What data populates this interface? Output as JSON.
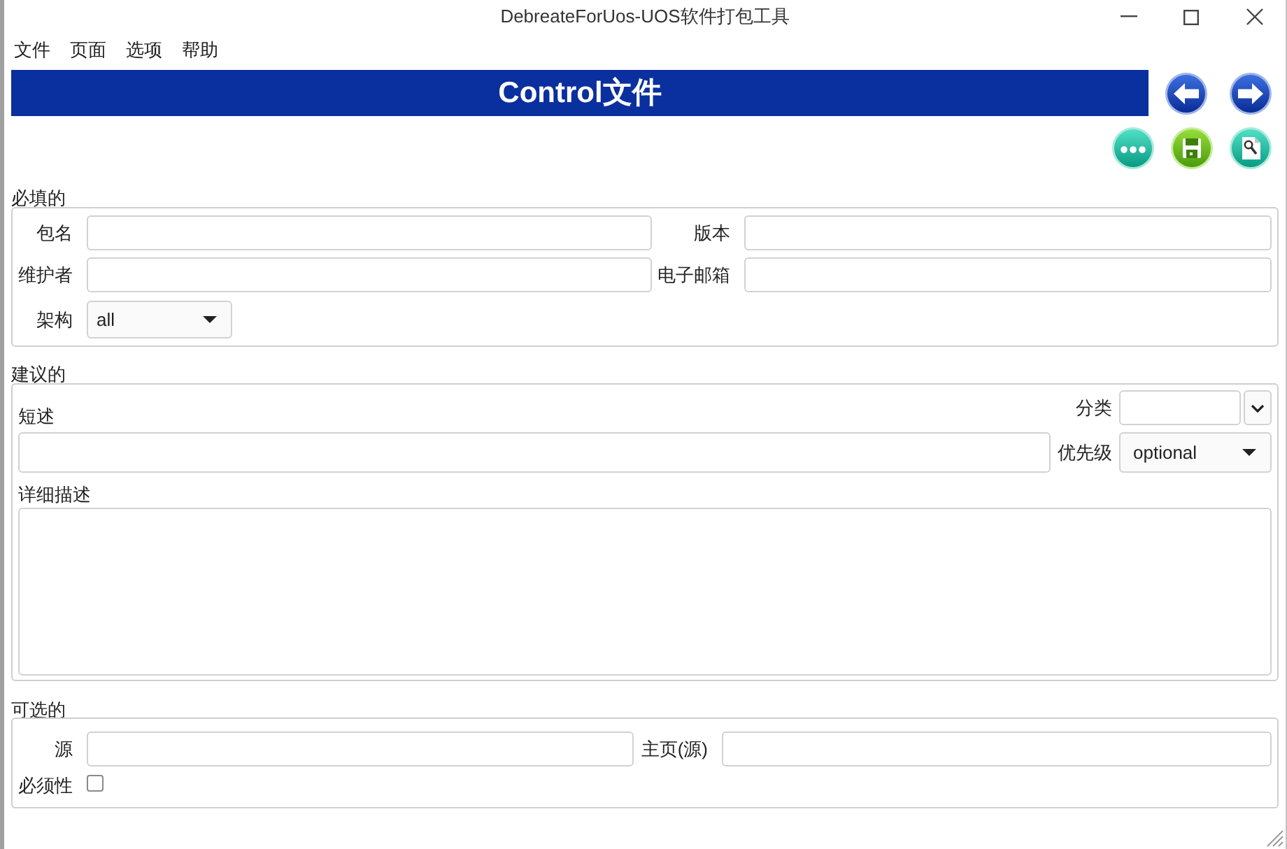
{
  "window": {
    "title": "DebreateForUos-UOS软件打包工具"
  },
  "menu": [
    {
      "label": "文件"
    },
    {
      "label": "页面"
    },
    {
      "label": "选项"
    },
    {
      "label": "帮助"
    }
  ],
  "banner": {
    "title": "Control文件"
  },
  "required": {
    "title": "必填的",
    "package": {
      "label": "包名"
    },
    "version": {
      "label": "版本"
    },
    "maintainer": {
      "label": "维护者"
    },
    "email": {
      "label": "电子邮箱"
    },
    "architecture": {
      "label": "架构",
      "value": "all"
    }
  },
  "recommended": {
    "title": "建议的",
    "section": {
      "label": "分类"
    },
    "short_description": {
      "label": "短述"
    },
    "priority": {
      "label": "优先级",
      "value": "optional"
    },
    "long_description": {
      "label": "详细描述"
    }
  },
  "optional": {
    "title": "可选的",
    "source": {
      "label": "源"
    },
    "homepage": {
      "label": "主页(源)"
    },
    "essential": {
      "label": "必须性",
      "checked": false
    }
  }
}
